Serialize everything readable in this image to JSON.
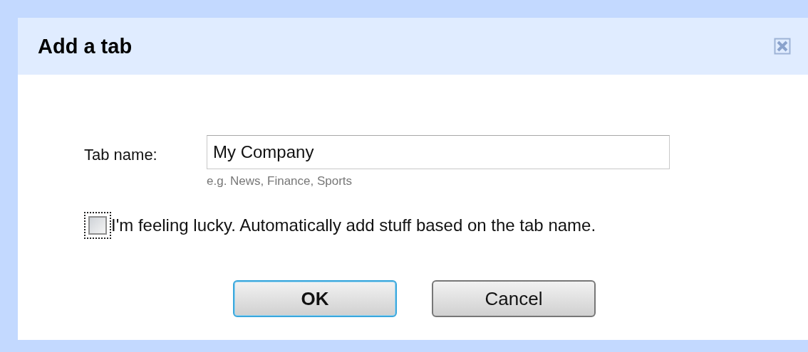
{
  "dialog": {
    "title": "Add a tab",
    "field": {
      "label": "Tab name:",
      "value": "My Company",
      "hint": "e.g. News, Finance, Sports"
    },
    "checkbox": {
      "label": "I'm feeling lucky. Automatically add stuff based on the tab name.",
      "checked": false,
      "focused": true
    },
    "buttons": [
      {
        "label": "OK",
        "default": true
      },
      {
        "label": "Cancel",
        "default": false
      }
    ]
  }
}
